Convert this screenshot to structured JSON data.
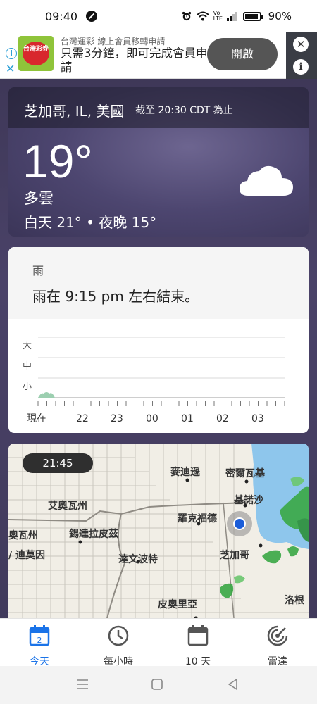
{
  "status_bar": {
    "time": "09:40",
    "battery": "90%",
    "volte": "Vo LTE"
  },
  "ad": {
    "logo_text": "台灣彩券",
    "headline_small": "台灣運彩-線上會員移轉申請",
    "headline_main": "只需3分鐘，即可完成會員申請",
    "cta": "開啟",
    "close": "✕",
    "info": "i"
  },
  "weather": {
    "location": "芝加哥, IL, 美國",
    "as_of": "截至 20:30 CDT 為止",
    "temperature": "19°",
    "condition": "多雲",
    "day_night": "白天 21° • 夜晚 15°",
    "icon": "cloud-icon"
  },
  "rain": {
    "title": "雨",
    "message": "雨在 9:15 pm 左右結束。",
    "levels": [
      "大",
      "中",
      "小"
    ],
    "time_labels": [
      "現在",
      "22",
      "23",
      "00",
      "01",
      "02",
      "03"
    ]
  },
  "map": {
    "time": "21:45",
    "labels": {
      "milwaukee": "密爾瓦基",
      "madison": "麥迪遜",
      "kenosha": "基諾沙",
      "eau_claire": "艾奧瓦州",
      "iowa": "奧瓦州",
      "dubuque": "/ 迪莫因",
      "pittsburg": "錫達拉皮茲",
      "rockford": "羅克福德",
      "chicago": "芝加哥",
      "davenport": "達文波特",
      "peoria": "皮奧里亞",
      "south_bend": "洛根"
    }
  },
  "bottom_nav": {
    "today": "今天",
    "today_date": "2",
    "hourly": "每小時",
    "ten_day": "10 天",
    "radar": "雷達"
  },
  "colors": {
    "accent": "#1a73e8",
    "lake": "#8ec6ec",
    "radar_green": "#3aa845"
  }
}
